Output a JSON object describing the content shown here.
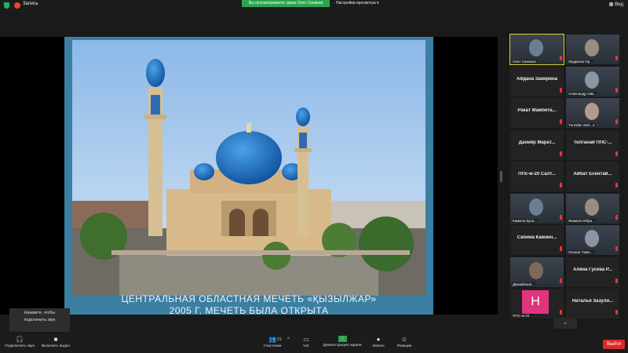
{
  "topbar": {
    "rec_label": "Запись",
    "viewing_text": "Вы просматриваете экран Олег Синяков",
    "view_options": "Настройки просмотра",
    "view_button": "Вид"
  },
  "slide": {
    "caption_line1": "ЦЕНТРАЛЬНАЯ ОБЛАСТНАЯ МЕЧЕТЬ «ҚЫЗЫЛЖАР»",
    "caption_line2": "2005 Г. МЕЧЕТЬ БЫЛА ОТКРЫТА"
  },
  "participants": [
    {
      "name": "Олег Синяков",
      "video": true,
      "active": true
    },
    {
      "name": "Людмила Пр...",
      "video": true
    },
    {
      "name": "Айдана Закирина",
      "video": false
    },
    {
      "name": "Александр Ник...",
      "video": true
    },
    {
      "name": "Ракат Мамбета...",
      "video": false
    },
    {
      "name": "Turmilan Sart...s",
      "video": true
    },
    {
      "name": "Данияр Марат...",
      "video": false
    },
    {
      "name": "Толганай ППС-...",
      "video": false
    },
    {
      "name": "ППс-м-20 Салт...",
      "video": false
    },
    {
      "name": "Айбат Есентай...",
      "video": false
    },
    {
      "name": "Камила Куса...",
      "video": true
    },
    {
      "name": "Жамиля Ибра...",
      "video": true
    },
    {
      "name": "Сабина Камзин...",
      "video": false
    },
    {
      "name": "Оксана Тамо...",
      "video": true
    },
    {
      "name": "Джамбеков...",
      "video": true
    },
    {
      "name": "Алёна Гусева Р...",
      "video": false
    },
    {
      "name": "ППС-м-20 ...",
      "video": true,
      "initial": "Н"
    },
    {
      "name": "Наталья Зазули...",
      "video": false
    }
  ],
  "gallery_more": "⌄",
  "tooltip": {
    "line1": "Нажмите, чтобы",
    "line2": "подключить звук"
  },
  "toolbar": {
    "connect_audio": "Подключить звук",
    "start_video": "Включить видео",
    "participants": "Участники",
    "participants_count": "21",
    "chat": "Чат",
    "share_screen": "Демонстрация экрана",
    "record": "Запись",
    "reactions": "Реакции",
    "exit": "Выйти"
  },
  "colors": {
    "accent_green": "#2da44e",
    "exit_red": "#e02828",
    "active_border": "#d8d13a"
  }
}
